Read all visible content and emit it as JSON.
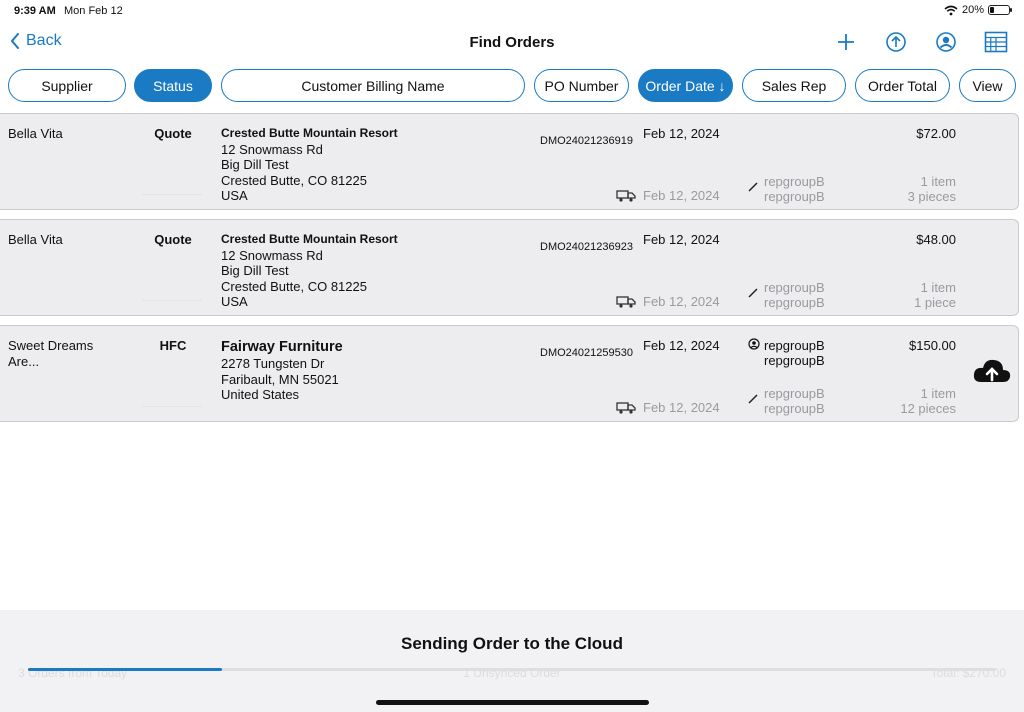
{
  "statusbar": {
    "time": "9:39 AM",
    "date": "Mon Feb 12",
    "battery": "20%",
    "battery_level": 0.2
  },
  "nav": {
    "back_label": "Back",
    "title": "Find Orders",
    "icons": [
      "plus-icon",
      "upload-icon",
      "user-circle-icon",
      "layout-grid-icon"
    ]
  },
  "filters": [
    {
      "label": "Supplier",
      "active": false
    },
    {
      "label": "Status",
      "active": true
    },
    {
      "label": "Customer Billing Name",
      "active": false
    },
    {
      "label": "PO Number",
      "active": false
    },
    {
      "label": "Order Date ↓",
      "active": true
    },
    {
      "label": "Sales Rep",
      "active": false
    },
    {
      "label": "Order Total",
      "active": false
    },
    {
      "label": "View",
      "active": false
    }
  ],
  "orders": [
    {
      "supplier": "Bella Vita",
      "status": "Quote",
      "customer": "Crested Butte Mountain Resort",
      "address": [
        "12 Snowmass Rd",
        "Big Dill Test",
        "Crested Butte, CO  81225",
        "USA"
      ],
      "po_number": "DMO24021236919",
      "order_date": "Feb 12, 2024",
      "ship_date": "Feb 12, 2024",
      "rep_primary": "repgroupB",
      "rep_secondary": "repgroupB",
      "total": "$72.00",
      "item_count": "1 item",
      "piece_count": "3 pieces"
    },
    {
      "supplier": "Bella Vita",
      "status": "Quote",
      "customer": "Crested Butte Mountain Resort",
      "address": [
        "12 Snowmass Rd",
        "Big Dill Test",
        "Crested Butte, CO  81225",
        "USA"
      ],
      "po_number": "DMO24021236923",
      "order_date": "Feb 12, 2024",
      "ship_date": "Feb 12, 2024",
      "rep_primary": "repgroupB",
      "rep_secondary": "repgroupB",
      "total": "$48.00",
      "item_count": "1 item",
      "piece_count": "1 piece"
    },
    {
      "supplier": "Sweet Dreams Are...",
      "status": "HFC",
      "customer": "Fairway Furniture",
      "address": [
        "2278 Tungsten Dr",
        "Faribault, MN  55021",
        "United States"
      ],
      "po_number": "DMO24021259530",
      "order_date": "Feb 12, 2024",
      "ship_date": "Feb 12, 2024",
      "owner_names": [
        "repgroupB",
        "repgroupB"
      ],
      "rep_primary": "repgroupB",
      "rep_secondary": "repgroupB",
      "total": "$150.00",
      "item_count": "1 item",
      "piece_count": "12 pieces",
      "cloud_icon": "cloud-upload-icon"
    }
  ],
  "bottom": {
    "message": "Sending Order to the Cloud",
    "progress": 0.2,
    "ghost_left": "3 Orders from Today",
    "ghost_center": "1 Unsynced Order",
    "ghost_right": "Total: $270.00"
  },
  "colors": {
    "accent": "#1a7ac4",
    "row_bg": "#ededf0",
    "muted": "#9a9a9f"
  }
}
